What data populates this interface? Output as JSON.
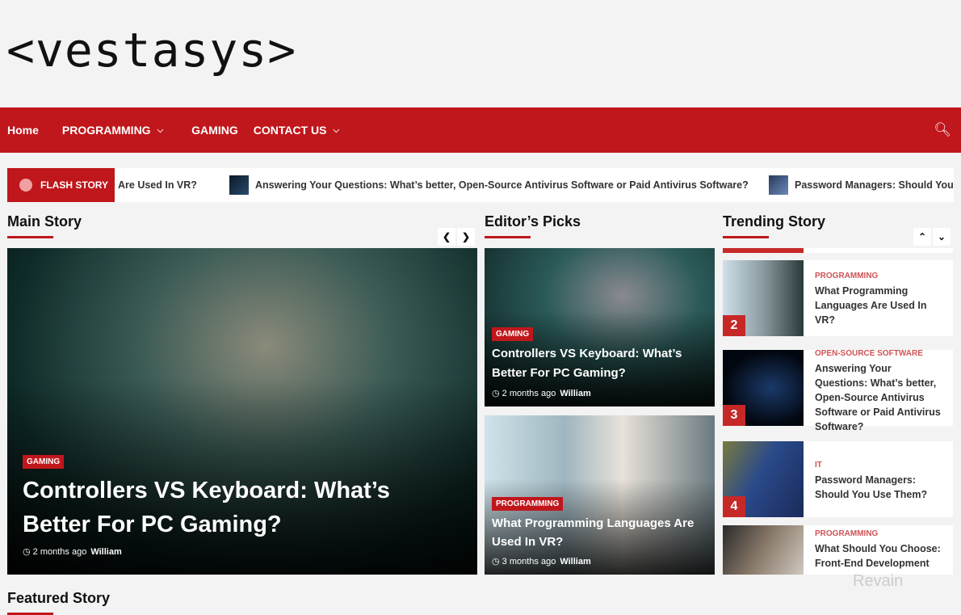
{
  "logo": "<vestasys>",
  "nav": {
    "items": [
      {
        "label": "Home"
      },
      {
        "label": "PROGRAMMING",
        "dropdown": true
      },
      {
        "label": "GAMING"
      },
      {
        "label": "CONTACT US",
        "dropdown": true
      }
    ],
    "search_icon": "search-icon"
  },
  "ticker": {
    "label": "FLASH STORY",
    "items": [
      "Are Used In VR?",
      "Answering Your Questions: What’s better, Open-Source Antivirus Software or Paid Antivirus Software?",
      "Password Managers: Should You U"
    ]
  },
  "sections": {
    "main": "Main Story",
    "editors": "Editor’s Picks",
    "trending": "Trending Story",
    "featured": "Featured Story"
  },
  "main_story": {
    "category": "GAMING",
    "title": "Controllers VS Keyboard: What’s Better For PC Gaming?",
    "time": "2 months ago",
    "author": "William"
  },
  "editors_picks": [
    {
      "category": "GAMING",
      "title": "Controllers VS Keyboard: What’s Better For PC Gaming?",
      "time": "2 months ago",
      "author": "William"
    },
    {
      "category": "PROGRAMMING",
      "title": "What Programming Languages Are Used In VR?",
      "time": "3 months ago",
      "author": "William"
    }
  ],
  "trending": [
    {
      "num": "2",
      "category": "PROGRAMMING",
      "title": "What Programming Languages Are Used In VR?"
    },
    {
      "num": "3",
      "category": "OPEN-SOURCE SOFTWARE",
      "title": "Answering Your Questions: What’s better, Open-Source Antivirus Software or Paid Antivirus Software?"
    },
    {
      "num": "4",
      "category": "IT",
      "title": "Password Managers: Should You Use Them?"
    },
    {
      "category": "PROGRAMMING",
      "title": "What Should You Choose: Front-End Development"
    }
  ],
  "watermark": "Revain",
  "colors": {
    "accent": "#c0171c"
  }
}
